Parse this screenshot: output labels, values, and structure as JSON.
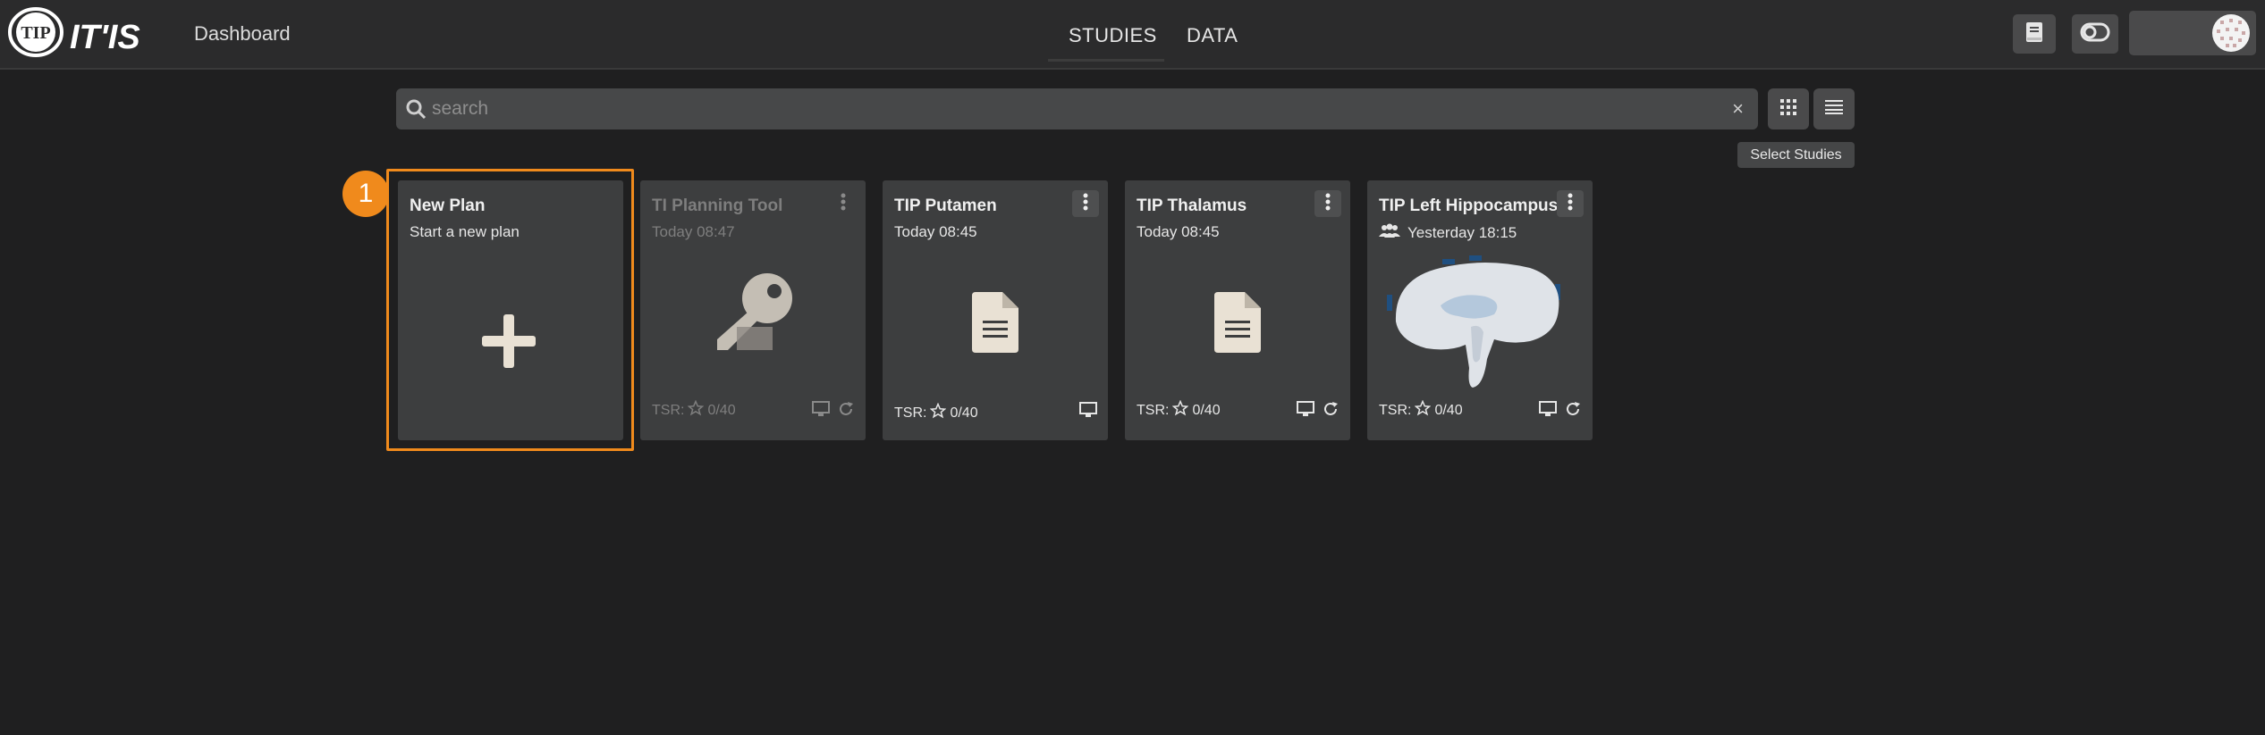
{
  "header": {
    "logo_text": "TIP",
    "logo_brand": "IT'IS",
    "title": "Dashboard",
    "tabs": [
      {
        "label": "STUDIES",
        "active": true
      },
      {
        "label": "DATA",
        "active": false
      }
    ],
    "buttons": [
      "manual-icon",
      "theme-toggle-icon"
    ],
    "user": {
      "avatar": "avatar-pattern"
    }
  },
  "search": {
    "placeholder": "search",
    "value": "",
    "clear_label": "×"
  },
  "toolbar": {
    "views": [
      "grid-view-icon",
      "list-view-icon"
    ],
    "tooltip": "Select Studies"
  },
  "tutorial": {
    "step": "1",
    "color": "#f08a1c"
  },
  "cards": [
    {
      "title": "New Plan",
      "subtitle": "Start a new plan",
      "icon": "plus-icon",
      "kind": "new"
    },
    {
      "title": "TI Planning Tool",
      "subtitle": "Today 08:47",
      "icon": "key-icon",
      "tsr": "0/40",
      "tsr_label": "TSR:",
      "footer": [
        "monitor-icon",
        "update-icon"
      ],
      "faded": true
    },
    {
      "title": "TIP Putamen",
      "subtitle": "Today 08:45",
      "icon": "document-icon",
      "tsr": "0/40",
      "tsr_label": "TSR:",
      "footer": [
        "monitor-icon"
      ]
    },
    {
      "title": "TIP Thalamus",
      "subtitle": "Today 08:45",
      "icon": "document-icon",
      "tsr": "0/40",
      "tsr_label": "TSR:",
      "footer": [
        "monitor-icon",
        "update-icon"
      ]
    },
    {
      "title": "TIP Left Hippocampus",
      "subtitle": "Yesterday 18:15",
      "icon": "brain-thumbnail",
      "shared": true,
      "tsr": "0/40",
      "tsr_label": "TSR:",
      "footer": [
        "monitor-icon",
        "update-icon"
      ]
    }
  ],
  "colors": {
    "background": "#1f1f20",
    "topbar": "#2b2b2c",
    "card": "#3d3e3f",
    "accent": "#f08a1c"
  }
}
